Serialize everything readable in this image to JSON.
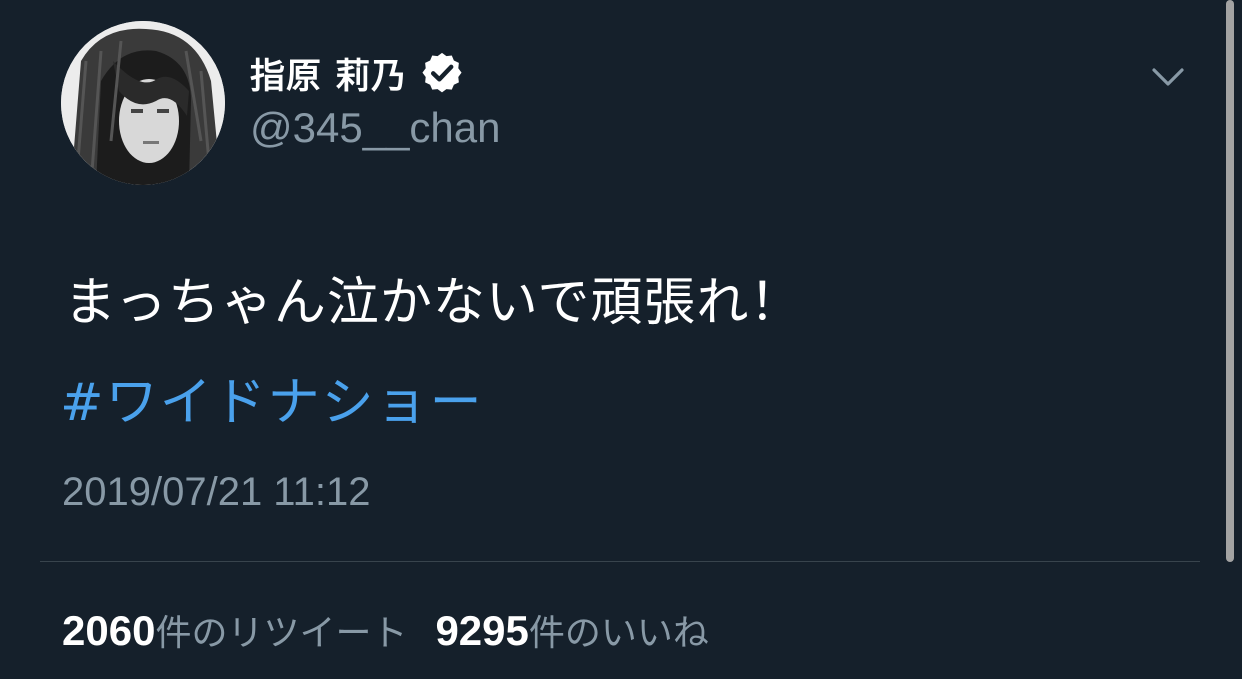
{
  "tweet": {
    "author": {
      "display_name": "指原 莉乃",
      "handle": "@345__chan",
      "verified": true,
      "avatar_icon": "profile-photo"
    },
    "text": "まっちゃん泣かないで頑張れ！",
    "hashtag": "#ワイドナショー",
    "timestamp": "2019/07/21 11:12",
    "stats": {
      "retweets_count": "2060",
      "retweets_label": "件のリツイート",
      "likes_count": "9295",
      "likes_label": "件のいいね"
    }
  },
  "colors": {
    "background": "#15202b",
    "text_primary": "#ffffff",
    "text_secondary": "#8899a6",
    "link": "#4aa1ec",
    "divider": "#38444d"
  },
  "icons": {
    "verified": "verified-badge-icon",
    "menu": "chevron-down-icon"
  }
}
